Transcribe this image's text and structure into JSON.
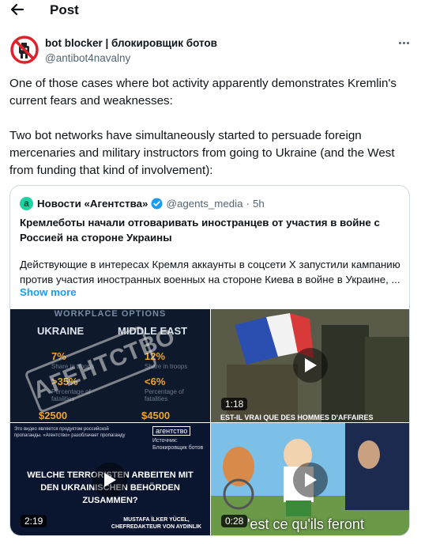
{
  "header": {
    "title": "Post",
    "back_icon": "arrow-left-icon"
  },
  "author": {
    "name": "bot blocker | блокировщик ботов",
    "handle": "@antibot4navalny",
    "avatar_icon": "no-bots-icon"
  },
  "post": {
    "paragraphs": [
      "One of those cases where bot activity apparently demonstrates Kremlin's current fears and weaknesses:",
      "Two bot networks have simultaneously started to persuade foreign mercenaries and military instructors from going to Ukraine (and the West from funding that kind of involvement):"
    ]
  },
  "quote": {
    "avatar_letter": "a",
    "name": "Новости «Агентства»",
    "handle": "@agents_media",
    "separator": "·",
    "time": "5h",
    "title": "Кремлеботы начали отговаривать иностранцев от участия в войне с Россией на стороне Украины",
    "body": "Действующие в интересах Кремля аккаунты в соцсети X запустили кампанию против участия иностранных военных на стороне Киева в войне в Украине, ...",
    "show_more": "Show more",
    "media": [
      {
        "kind": "image",
        "header": "WORKPLACE OPTIONS",
        "left_col": "UKRAINE",
        "right_col": "MIDDLE EAST",
        "left_stats": [
          "7%",
          ">35%",
          "$2500"
        ],
        "right_stats": [
          "12%",
          "<6%",
          "$4500"
        ],
        "stat_sub_1": "Share in troops",
        "stat_sub_2": "Percentage of fatalities",
        "watermark": "АГЕНТСТВО"
      },
      {
        "kind": "video",
        "duration": "1:18",
        "caption": "EST-IL VRAI QUE DES HOMMES D'AFFAIRES"
      },
      {
        "kind": "video",
        "duration": "2:19",
        "top_text": "Это видео является продуктом российской пропаганды. «Агентство» разоблачает пропаганду",
        "logo": "агентство",
        "source": "Источник: Блокировщик ботов",
        "main_text": "WELCHE TERRORISTEN ARBEITEN MIT DEN UKRAINISCHEN BEHÖRDEN ZUSAMMEN?",
        "credit": "MUSTAFA İLKER YÜCEL, CHEFREDAKTEUR VON AYDINLIK"
      },
      {
        "kind": "video",
        "duration": "0:28",
        "caption": "'est ce qu'ils feront"
      }
    ]
  },
  "colors": {
    "accent": "#1d9bf0",
    "muted": "#536471",
    "border": "#cfd9de",
    "highlight": "#f0a428"
  }
}
